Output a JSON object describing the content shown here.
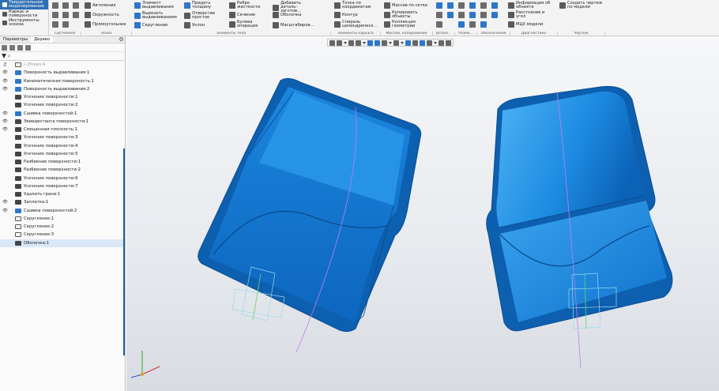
{
  "ribbon": {
    "modes": [
      {
        "label": "Твердотельное моделирование",
        "active": true
      },
      {
        "label": "Каркас и поверхности",
        "active": false
      },
      {
        "label": "Инструменты эскиза",
        "active": false
      }
    ],
    "buttons": {
      "autoline": "Автолиния",
      "circle": "Окружность",
      "rectangle": "Прямоугольник",
      "element_extrude": "Элемент выдавливания",
      "cut_extrude": "Вырезать выдавливанием",
      "fillet": "Скругление",
      "add_thickness": "Придать толщину",
      "simple_hole": "Отверстие простое",
      "draft": "Уклон",
      "rib": "Ребро жесткости",
      "section": "Сечение",
      "boolean": "Булева операция",
      "add_part": "Добавить деталь-заготов...",
      "shell": "Оболочка",
      "scale": "Масштабиров...",
      "point_coords": "Точка по координатам",
      "contour": "Контур",
      "spiral": "Спираль цилиндрическ...",
      "array_grid": "Массив по сетке",
      "copy_objects": "Копировать объекты",
      "collection": "Коллекция геометрии",
      "object_info": "Информация об объекте",
      "distance_angle": "Расстояние и угол",
      "mass_props": "МЦХ модели",
      "create_drawing": "Создать чертеж по модели"
    },
    "group_labels": [
      "Системная",
      "Эскиз",
      "Элементы тела",
      "Элементы каркаса",
      "Массив, копирование",
      "Вспом...",
      "Разме...",
      "Обозначения",
      "Диагностика",
      "Чертеж"
    ]
  },
  "panel": {
    "title": "Параметры",
    "tab": "Дерево",
    "search_placeholder": "ρ",
    "tree": [
      {
        "label": "(-)Эскиз:4",
        "eye": "👁̸",
        "icon": "outline",
        "faded": true
      },
      {
        "label": "Поверхность выдавливания:1",
        "eye": "👁",
        "icon": "blue"
      },
      {
        "label": "Кинематическая поверхность:1",
        "eye": "👁",
        "icon": "blue"
      },
      {
        "label": "Поверхность выдавливания:2",
        "eye": "👁",
        "icon": "blue"
      },
      {
        "label": "Усечение поверхности:1",
        "eye": "",
        "icon": "dark"
      },
      {
        "label": "Усечение поверхности:2",
        "eye": "",
        "icon": "dark"
      },
      {
        "label": "Сшивка поверхностей:1",
        "eye": "👁",
        "icon": "blue"
      },
      {
        "label": "Эквидистанта поверхности:1",
        "eye": "👁",
        "icon": "dark"
      },
      {
        "label": "Смещенная плоскость:1",
        "eye": "👁",
        "icon": "dark"
      },
      {
        "label": "Усечение поверхности:3",
        "eye": "",
        "icon": "dark"
      },
      {
        "label": "Усечение поверхности:4",
        "eye": "",
        "icon": "dark"
      },
      {
        "label": "Усечение поверхности:5",
        "eye": "",
        "icon": "dark"
      },
      {
        "label": "Разбиение поверхности:1",
        "eye": "",
        "icon": "dark"
      },
      {
        "label": "Разбиение поверхности:2",
        "eye": "",
        "icon": "dark"
      },
      {
        "label": "Усечение поверхности:6",
        "eye": "",
        "icon": "dark"
      },
      {
        "label": "Усечение поверхности:7",
        "eye": "",
        "icon": "dark"
      },
      {
        "label": "Удалить грани:1",
        "eye": "",
        "icon": "dark"
      },
      {
        "label": "Заплатка:1",
        "eye": "👁",
        "icon": "dark"
      },
      {
        "label": "Сшивка поверхностей:2",
        "eye": "👁",
        "icon": "blue"
      },
      {
        "label": "Скругление:1",
        "eye": "",
        "icon": "outline"
      },
      {
        "label": "Скругление:2",
        "eye": "",
        "icon": "outline"
      },
      {
        "label": "Скругление:3",
        "eye": "",
        "icon": "outline"
      },
      {
        "label": "Оболочка:1",
        "eye": "",
        "icon": "dark",
        "selected": true
      }
    ]
  },
  "colors": {
    "accent": "#2e6fb4",
    "model_blue": "#1a8fe0",
    "model_dark": "#0d5fb0",
    "background": "#e7eaee"
  }
}
